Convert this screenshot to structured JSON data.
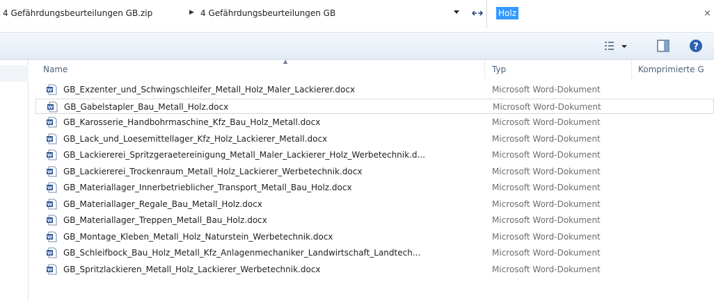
{
  "address": {
    "crumbs": [
      "4 Gefährdungsbeurteilungen GB.zip",
      "4 Gefährdungsbeurteilungen GB"
    ],
    "separator": "▶"
  },
  "search": {
    "value": "Holz",
    "clear_glyph": "×"
  },
  "toolbar": {
    "views_icon": "views-icon",
    "pane_icon": "preview-pane-icon",
    "help_icon": "help-icon"
  },
  "columns": {
    "name": "Name",
    "type": "Typ",
    "compressed": "Komprimierte G"
  },
  "files": [
    {
      "name": "GB_Exzenter_und_Schwingschleifer_Metall_Holz_Maler_Lackierer.docx",
      "type": "Microsoft Word-Dokument"
    },
    {
      "name": "GB_Gabelstapler_Bau_Metall_Holz.docx",
      "type": "Microsoft Word-Dokument"
    },
    {
      "name": "GB_Karosserie_Handbohrmaschine_Kfz_Bau_Holz_Metall.docx",
      "type": "Microsoft Word-Dokument"
    },
    {
      "name": "GB_Lack_und_Loesemittellager_Kfz_Holz_Lackierer_Metall.docx",
      "type": "Microsoft Word-Dokument"
    },
    {
      "name": "GB_Lackiererei_Spritzgeraetereinigung_Metall_Maler_Lackierer_Holz_Werbetechnik.d...",
      "type": "Microsoft Word-Dokument"
    },
    {
      "name": "GB_Lackiererei_Trockenraum_Metall_Holz_Lackierer_Werbetechnik.docx",
      "type": "Microsoft Word-Dokument"
    },
    {
      "name": "GB_Materiallager_Innerbetrieblicher_Transport_Metall_Bau_Holz.docx",
      "type": "Microsoft Word-Dokument"
    },
    {
      "name": "GB_Materiallager_Regale_Bau_Metall_Holz.docx",
      "type": "Microsoft Word-Dokument"
    },
    {
      "name": "GB_Materiallager_Treppen_Metall_Bau_Holz.docx",
      "type": "Microsoft Word-Dokument"
    },
    {
      "name": "GB_Montage_Kleben_Metall_Holz_Naturstein_Werbetechnik.docx",
      "type": "Microsoft Word-Dokument"
    },
    {
      "name": "GB_Schleifbock_Bau_Holz_Metall_Kfz_Anlagenmechaniker_Landwirtschaft_Landtech...",
      "type": "Microsoft Word-Dokument"
    },
    {
      "name": "GB_Spritzlackieren_Metall_Holz_Lackierer_Werbetechnik.docx",
      "type": "Microsoft Word-Dokument"
    }
  ],
  "colors": {
    "selection": "#3399ff",
    "header_text": "#4c607a",
    "type_text": "#6d6d6d",
    "word_blue": "#2b5797"
  }
}
